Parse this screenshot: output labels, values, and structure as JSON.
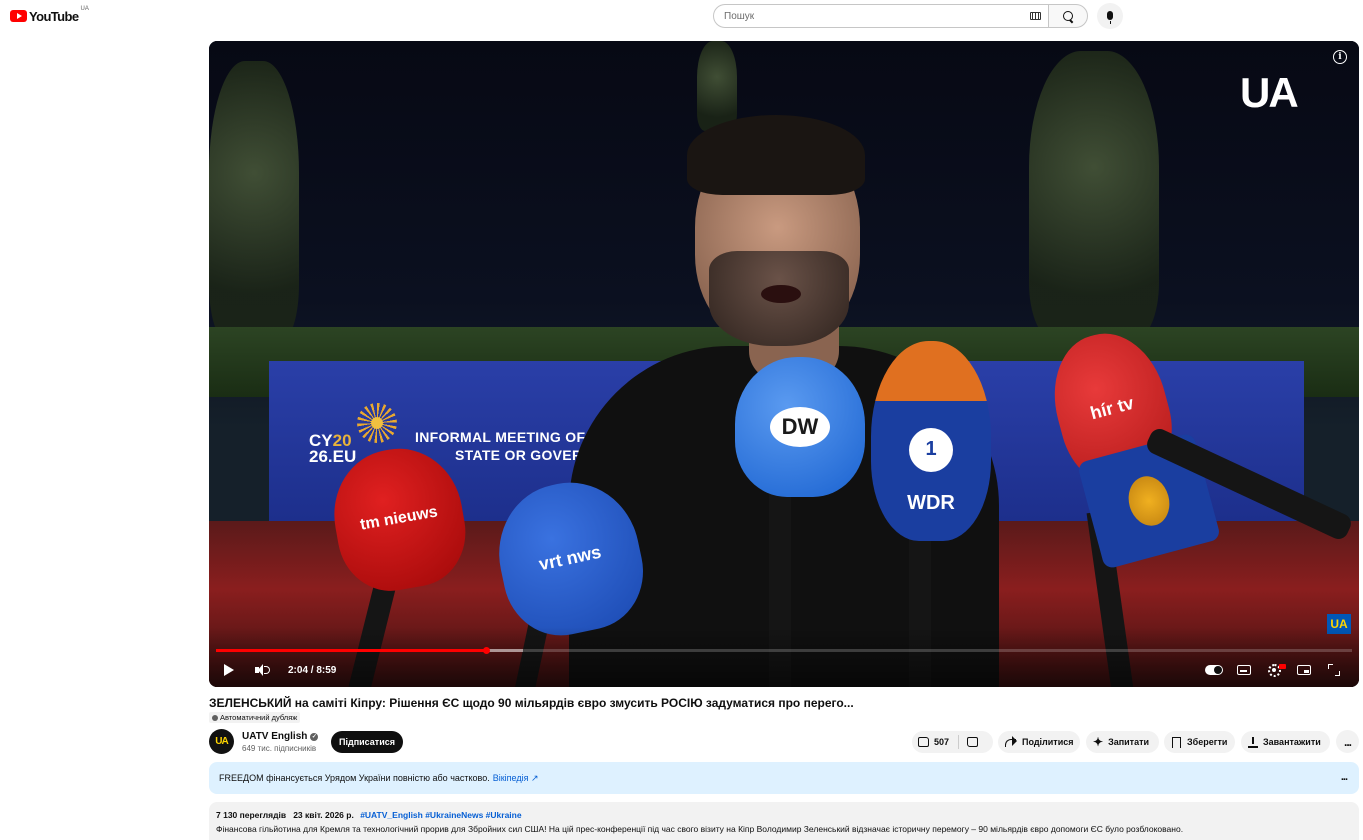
{
  "masthead": {
    "logo_text": "YouTube",
    "logo_country": "UA",
    "search_placeholder": "Пошук"
  },
  "player": {
    "overlay_logo": "UA",
    "corner_badge": "UA",
    "banner": {
      "cy_prefix": "CY",
      "cy_year_top": "20",
      "cy_year_bottom": "26",
      "cy_suffix": ".EU",
      "line1": "INFORMAL MEETING OF",
      "line2": "STATE OR GOVER"
    },
    "mic_labels": {
      "dw": "DW",
      "tm": "tm nieuws",
      "vrt": "vrt nws",
      "wdr": "WDR",
      "first": "1",
      "hirtv": "hír tv"
    },
    "time_display": "2:04 / 8:59",
    "progress_played": 0.238,
    "progress_buffered": 0.27
  },
  "video": {
    "title": "ЗЕЛЕНСЬКИЙ на саміті Кіпру: Рішення ЄС щодо 90 мільярдів євро змусить РОСІЮ задуматися про перего...",
    "dub_label": "Автоматичний дубляж"
  },
  "channel": {
    "avatar_text": "UA",
    "name": "UATV English",
    "subscribers": "649 тис. підписників",
    "subscribe_label": "Підписатися"
  },
  "actions": {
    "likes": "507",
    "share": "Поділитися",
    "ask": "Запитати",
    "save": "Зберегти",
    "download": "Завантажити",
    "more": "..."
  },
  "notice": {
    "text": "FREEДOM фінансується Урядом України повністю або частково.",
    "link": "Вікіпедія ↗",
    "more": "..."
  },
  "description": {
    "views": "7 130 переглядів",
    "date": "23 квіт. 2026 р.",
    "tags": "#UATV_English #UkraineNews #Ukraine",
    "text": "Фінансова гільйотина для Кремля та технологічний прорив для Збройних сил США! На цій прес-конференції під час свого візиту на Кіпр Володимир Зеленський відзначає історичну перемогу – 90 мільярдів євро допомоги ЄС було розблоковано."
  }
}
